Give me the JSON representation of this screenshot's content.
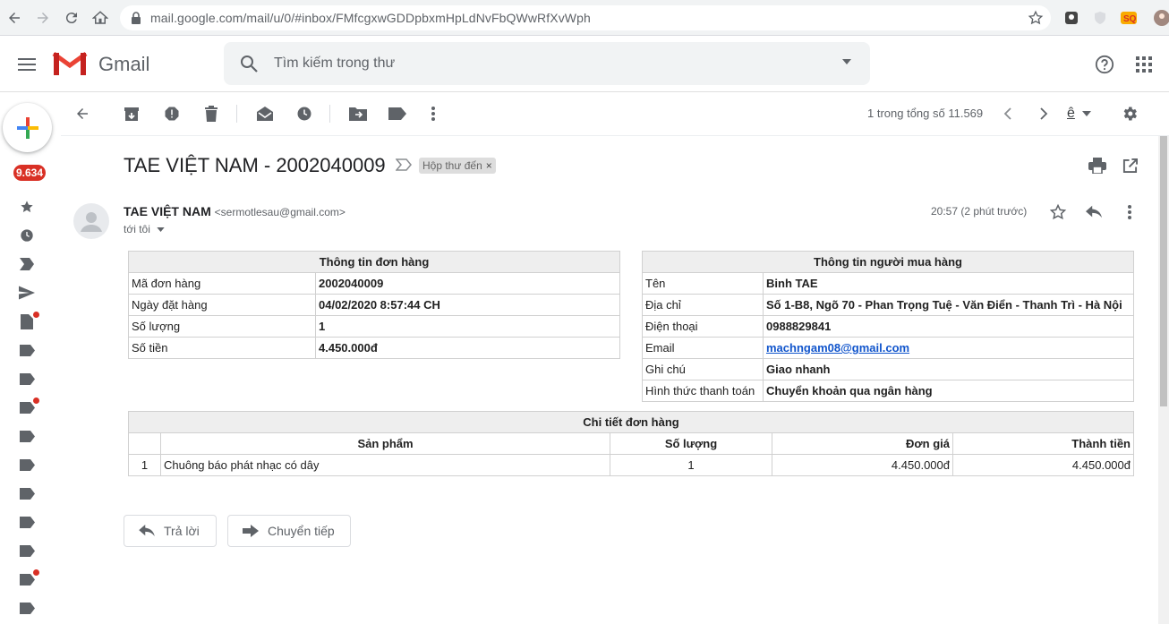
{
  "browser": {
    "url": "mail.google.com/mail/u/0/#inbox/FMfcgxwGDDpbxmHpLdNvFbQWwRfXvWph"
  },
  "header": {
    "app_name": "Gmail",
    "search_placeholder": "Tìm kiếm trong thư"
  },
  "sidebar": {
    "unread_badge": "9.634"
  },
  "toolbar": {
    "pagination": "1 trong tổng số 11.569",
    "input_tool": "ê"
  },
  "email": {
    "subject": "TAE VIỆT NAM - 2002040009",
    "label": "Hộp thư đến",
    "sender_name": "TAE VIỆT NAM",
    "sender_email": "<sermotlesau@gmail.com>",
    "to": "tới tôi",
    "time": "20:57 (2 phút trước)"
  },
  "order_info": {
    "title": "Thông tin đơn hàng",
    "rows": [
      {
        "label": "Mã đơn hàng",
        "value": "2002040009"
      },
      {
        "label": "Ngày đặt hàng",
        "value": "04/02/2020 8:57:44 CH"
      },
      {
        "label": "Số lượng",
        "value": "1"
      },
      {
        "label": "Số tiền",
        "value": "4.450.000đ"
      }
    ]
  },
  "buyer_info": {
    "title": "Thông tin người mua hàng",
    "rows": [
      {
        "label": "Tên",
        "value": "Binh TAE"
      },
      {
        "label": "Địa chỉ",
        "value": "Số 1-B8, Ngõ 70 - Phan Trọng Tuệ - Văn Điển - Thanh Trì - Hà Nội"
      },
      {
        "label": "Điện thoại",
        "value": "0988829841"
      },
      {
        "label": "Email",
        "value": "machngam08@gmail.com"
      },
      {
        "label": "Ghi chú",
        "value": "Giao nhanh"
      },
      {
        "label": "Hình thức thanh toán",
        "value": "Chuyển khoản qua ngân hàng"
      }
    ]
  },
  "order_detail": {
    "title": "Chi tiết đơn hàng",
    "columns": [
      "Sản phẩm",
      "Số lượng",
      "Đơn giá",
      "Thành tiền"
    ],
    "items": [
      {
        "index": "1",
        "product": "Chuông báo phát nhạc có dây",
        "qty": "1",
        "unit_price": "4.450.000đ",
        "total": "4.450.000đ"
      }
    ]
  },
  "actions": {
    "reply": "Trả lời",
    "forward": "Chuyển tiếp"
  },
  "colors": {
    "badge_red": "#d93025",
    "link_blue": "#1155cc",
    "icon_gray": "#5f6368"
  }
}
